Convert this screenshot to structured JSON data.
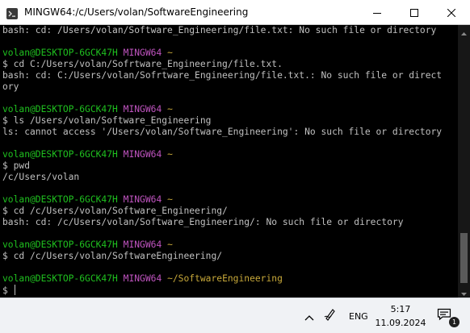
{
  "window": {
    "title": "MINGW64:/c/Users/volan/SoftwareEngineering"
  },
  "terminal": {
    "lines": [
      [
        {
          "t": "bash: cd: /Users/volan/Software_Engineering/file.txt: No such file or directory",
          "c": "white"
        }
      ],
      [
        {
          "t": "",
          "c": "white"
        }
      ],
      [
        {
          "t": "volan@DESKTOP-6GCK47H",
          "c": "green"
        },
        {
          "t": " ",
          "c": "white"
        },
        {
          "t": "MINGW64",
          "c": "magenta"
        },
        {
          "t": " ",
          "c": "white"
        },
        {
          "t": "~",
          "c": "yellow"
        }
      ],
      [
        {
          "t": "$ cd C:/Users/volan/Sofrtware_Engineering/file.txt.",
          "c": "white"
        }
      ],
      [
        {
          "t": "bash: cd: C:/Users/volan/Sofrtware_Engineering/file.txt.: No such file or direct",
          "c": "white"
        }
      ],
      [
        {
          "t": "ory",
          "c": "white"
        }
      ],
      [
        {
          "t": "",
          "c": "white"
        }
      ],
      [
        {
          "t": "volan@DESKTOP-6GCK47H",
          "c": "green"
        },
        {
          "t": " ",
          "c": "white"
        },
        {
          "t": "MINGW64",
          "c": "magenta"
        },
        {
          "t": " ",
          "c": "white"
        },
        {
          "t": "~",
          "c": "yellow"
        }
      ],
      [
        {
          "t": "$ ls /Users/volan/Software_Engineering",
          "c": "white"
        }
      ],
      [
        {
          "t": "ls: cannot access '/Users/volan/Software_Engineering': No such file or directory",
          "c": "white"
        }
      ],
      [
        {
          "t": "",
          "c": "white"
        }
      ],
      [
        {
          "t": "volan@DESKTOP-6GCK47H",
          "c": "green"
        },
        {
          "t": " ",
          "c": "white"
        },
        {
          "t": "MINGW64",
          "c": "magenta"
        },
        {
          "t": " ",
          "c": "white"
        },
        {
          "t": "~",
          "c": "yellow"
        }
      ],
      [
        {
          "t": "$ pwd",
          "c": "white"
        }
      ],
      [
        {
          "t": "/c/Users/volan",
          "c": "white"
        }
      ],
      [
        {
          "t": "",
          "c": "white"
        }
      ],
      [
        {
          "t": "volan@DESKTOP-6GCK47H",
          "c": "green"
        },
        {
          "t": " ",
          "c": "white"
        },
        {
          "t": "MINGW64",
          "c": "magenta"
        },
        {
          "t": " ",
          "c": "white"
        },
        {
          "t": "~",
          "c": "yellow"
        }
      ],
      [
        {
          "t": "$ cd /c/Users/volan/Software_Engineering/",
          "c": "white"
        }
      ],
      [
        {
          "t": "bash: cd: /c/Users/volan/Software_Engineering/: No such file or directory",
          "c": "white"
        }
      ],
      [
        {
          "t": "",
          "c": "white"
        }
      ],
      [
        {
          "t": "volan@DESKTOP-6GCK47H",
          "c": "green"
        },
        {
          "t": " ",
          "c": "white"
        },
        {
          "t": "MINGW64",
          "c": "magenta"
        },
        {
          "t": " ",
          "c": "white"
        },
        {
          "t": "~",
          "c": "yellow"
        }
      ],
      [
        {
          "t": "$ cd /c/Users/volan/SoftwareEngineering/",
          "c": "white"
        }
      ],
      [
        {
          "t": "",
          "c": "white"
        }
      ],
      [
        {
          "t": "volan@DESKTOP-6GCK47H",
          "c": "green"
        },
        {
          "t": " ",
          "c": "white"
        },
        {
          "t": "MINGW64",
          "c": "magenta"
        },
        {
          "t": " ",
          "c": "white"
        },
        {
          "t": "~/SoftwareEngineering",
          "c": "yellow"
        }
      ],
      [
        {
          "t": "$ ",
          "c": "white"
        }
      ]
    ]
  },
  "taskbar": {
    "language": "ENG",
    "time": "5:17",
    "date": "11.09.2024",
    "notification_count": "1"
  },
  "colors": {
    "prompt_user": "#1fc11f",
    "prompt_system": "#c054c0",
    "prompt_path": "#c8a93a",
    "terminal_text": "#c0c0c0",
    "terminal_bg": "#000000"
  },
  "icons": {
    "app": "mingw-terminal-icon",
    "minimize": "minimize-icon",
    "maximize": "maximize-icon",
    "close": "close-icon",
    "tray_overflow": "chevron-up-icon",
    "pen": "pen-icon",
    "notifications": "notification-center-icon"
  }
}
